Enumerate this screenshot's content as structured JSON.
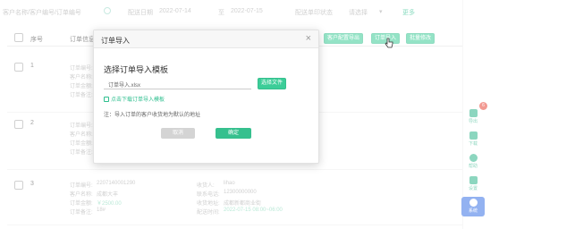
{
  "search": {
    "label_customer": "客户名称/客户编号/订单编号",
    "label_date_from": "配送日期",
    "date_from": "2022-07-14",
    "date_sep": "至",
    "date_to": "2022-07-15",
    "label_status": "配送单印状态",
    "status_value": "请选择",
    "action_more": "更多"
  },
  "toolbar": {
    "export_button": "客户配置导出",
    "import_button": "订单导入",
    "batch_button": "批量修改"
  },
  "table": {
    "col_index": "序号",
    "col_order_info": "订单信息",
    "rows": [
      {
        "index": "1",
        "lines": [
          "订单编号:",
          "客户名称:",
          "订单金额:",
          "订单备注:"
        ]
      },
      {
        "index": "2",
        "lines": [
          "订单编号:",
          "客户名称:",
          "订单金额:",
          "订单备注:"
        ]
      },
      {
        "index": "3",
        "order_no_label": "订单编号:",
        "order_no": "2207140001290",
        "customer_label": "客户名称:",
        "customer": "成都大丰",
        "amount_label": "订单金额:",
        "amount": "￥2500.00",
        "remark_label": "订单备注:",
        "remark": "18#",
        "receiver_label": "收货人:",
        "receiver": "lihao",
        "phone_label": "联系电话:",
        "phone": "12300000000",
        "address_label": "收货地址:",
        "address": "成都新都商业街",
        "delivery_label": "配送时间:",
        "delivery": "2022-07-15 08:00~06:00"
      }
    ]
  },
  "sidebar": {
    "badge": "6",
    "items": [
      {
        "label": "导出"
      },
      {
        "label": "下载"
      },
      {
        "label": "帮助"
      },
      {
        "label": "设置"
      },
      {
        "label": "系统"
      }
    ]
  },
  "modal": {
    "title": "订单导入",
    "close": "×",
    "heading": "选择订单导入模板",
    "file_value": "订单导入.xlsx",
    "select_button": "选择文件",
    "template_link": "点击下载订单导入模板",
    "note": "注：导入订单的客户收货地为默认的地址",
    "cancel_button": "取消",
    "ok_button": "确定"
  },
  "colors": {
    "accent_green": "#36c08e",
    "link_green": "#2fbf8f",
    "active_blue": "#3b73e6",
    "badge_red": "#e8473a"
  }
}
